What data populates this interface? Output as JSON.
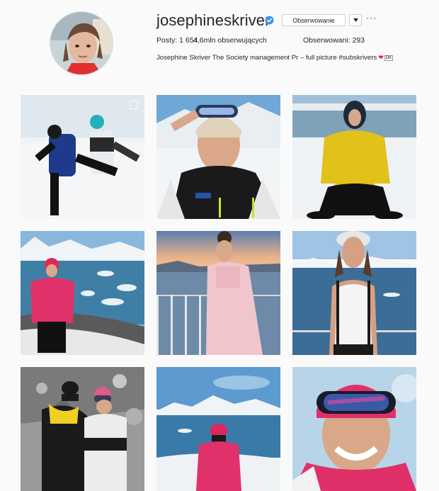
{
  "profile": {
    "username": "josephineskriver",
    "follow_label": "Obserwowanie",
    "more_label": "···",
    "stats": {
      "posts": "Posty: 1 654",
      "followers": "4,6mln obserwujących",
      "following": "Obserwowani: 293"
    },
    "bio": "Josephine Skriver The Society management Pr – full picture #subskrivers",
    "bio_flag": "DK"
  },
  "icons": {
    "verified": "verified-badge-icon",
    "dropdown": "chevron-down-icon",
    "multi_photo": "multiple-photos-icon"
  },
  "colors": {
    "verified": "#3897f0",
    "background": "#fafafa",
    "border": "#dbdbdb"
  },
  "posts": [
    {
      "id": "post-1",
      "scene": "snow-couple-jump"
    },
    {
      "id": "post-2",
      "scene": "goggles-selfie"
    },
    {
      "id": "post-3",
      "scene": "yellow-jacket-snow"
    },
    {
      "id": "post-4",
      "scene": "pink-jacket-glacier"
    },
    {
      "id": "post-5",
      "scene": "sunset-deck"
    },
    {
      "id": "post-6",
      "scene": "white-tank-deck"
    },
    {
      "id": "post-7",
      "scene": "couple-rocks"
    },
    {
      "id": "post-8",
      "scene": "pink-hat-bay"
    },
    {
      "id": "post-9",
      "scene": "pink-goggles-closeup"
    }
  ]
}
